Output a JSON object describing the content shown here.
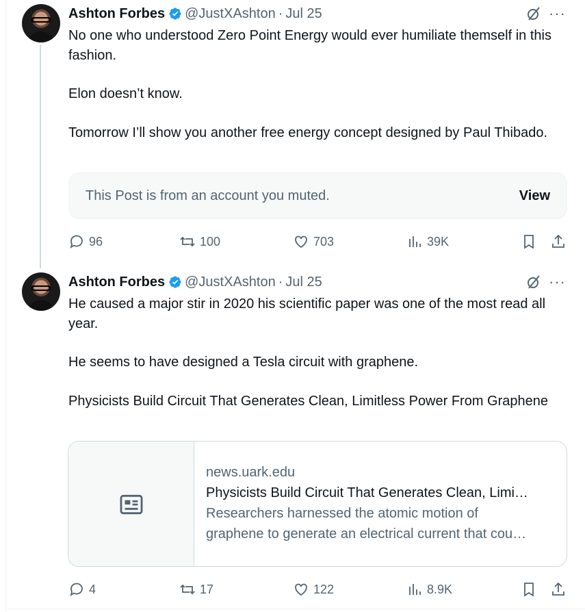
{
  "posts": [
    {
      "author_name": "Ashton Forbes",
      "handle": "@JustXAshton",
      "separator": "·",
      "date": "Jul 25",
      "paragraphs": [
        "No one who understood Zero Point Energy would ever humiliate themself in this fashion.",
        "Elon doesn’t know.",
        "Tomorrow I’ll show you another free energy concept designed by Paul Thibado."
      ],
      "muted_notice": "This Post is from an account you muted.",
      "muted_action": "View",
      "replies": "96",
      "reposts": "100",
      "likes": "703",
      "views": "39K"
    },
    {
      "author_name": "Ashton Forbes",
      "handle": "@JustXAshton",
      "separator": "·",
      "date": "Jul 25",
      "paragraphs": [
        "He caused a major stir in 2020 his scientific paper was one of the most read all year.",
        "He seems to have designed a Tesla circuit with graphene.",
        "Physicists Build Circuit That Generates Clean, Limitless Power From Graphene"
      ],
      "link_card": {
        "domain": "news.uark.edu",
        "title": "Physicists Build Circuit That Generates Clean, Limi…",
        "desc_line1": "Researchers harnessed the atomic motion of",
        "desc_line2": "graphene to generate an electrical current that cou…"
      },
      "replies": "4",
      "reposts": "17",
      "likes": "122",
      "views": "8.9K"
    }
  ],
  "colors": {
    "verified_blue": "#1d9bf0",
    "secondary_text": "#536471",
    "primary_text": "#0f1419",
    "border": "#cfd9de"
  },
  "icons": [
    "reply-icon",
    "repost-icon",
    "like-icon",
    "views-icon",
    "bookmark-icon",
    "share-icon",
    "grok-icon",
    "more-icon",
    "article-icon",
    "verified-badge-icon"
  ]
}
